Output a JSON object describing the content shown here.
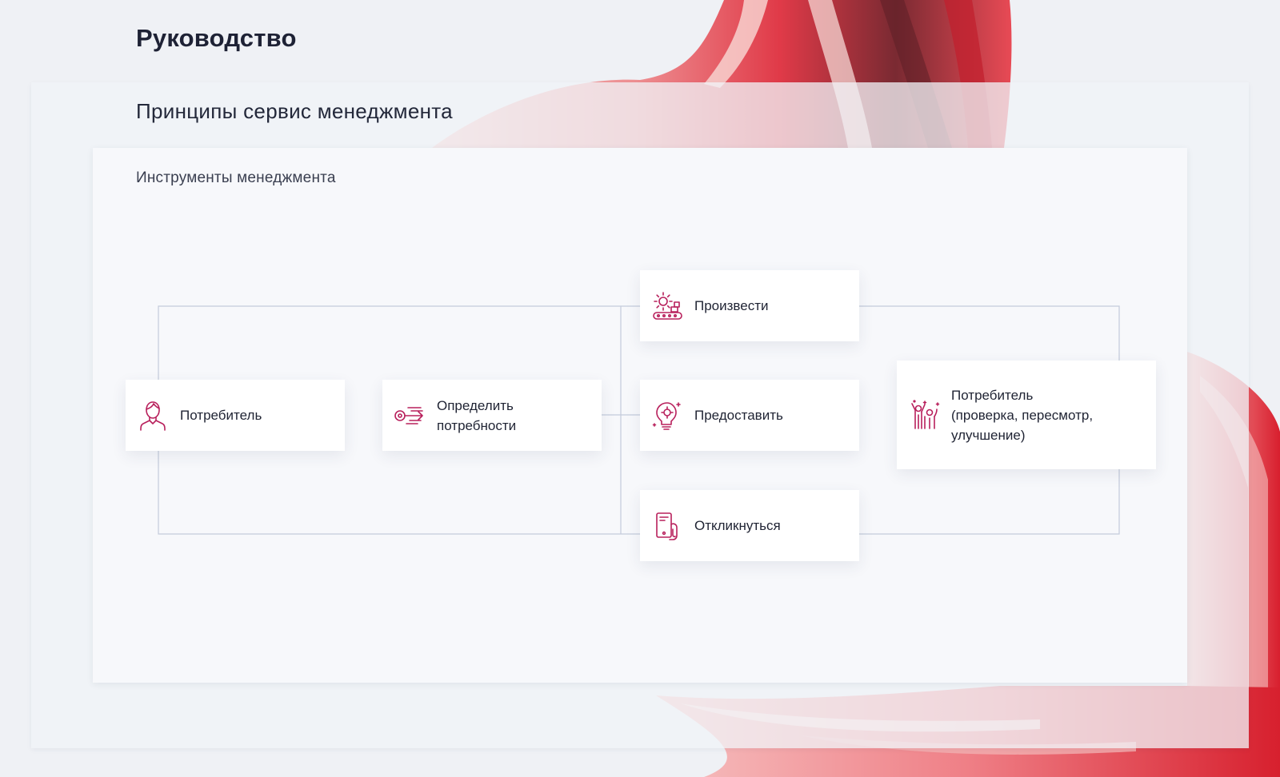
{
  "page": {
    "title": "Руководство",
    "section_title": "Принципы сервис менеджмента",
    "diagram_title": "Инструменты менеджмента"
  },
  "colors": {
    "accent": "#b8205c",
    "connector": "#c4cbdb",
    "brush_red": "#e0283a",
    "brush_pink": "#f2a6aa"
  },
  "nodes": {
    "consumer": {
      "label": "Потребитель",
      "icon": "user-icon"
    },
    "define_needs": {
      "label": "Определить\nпотребности",
      "icon": "filter-arrow-icon"
    },
    "produce": {
      "label": "Произвести",
      "icon": "gear-conveyor-icon"
    },
    "provide": {
      "label": "Предоставить",
      "icon": "lightbulb-gear-icon"
    },
    "respond": {
      "label": "Откликнуться",
      "icon": "phone-hand-icon"
    },
    "consumer_review": {
      "label": "Потребитель\n(проверка, пересмотр,\nулучшение)",
      "icon": "people-celebrate-icon"
    }
  }
}
